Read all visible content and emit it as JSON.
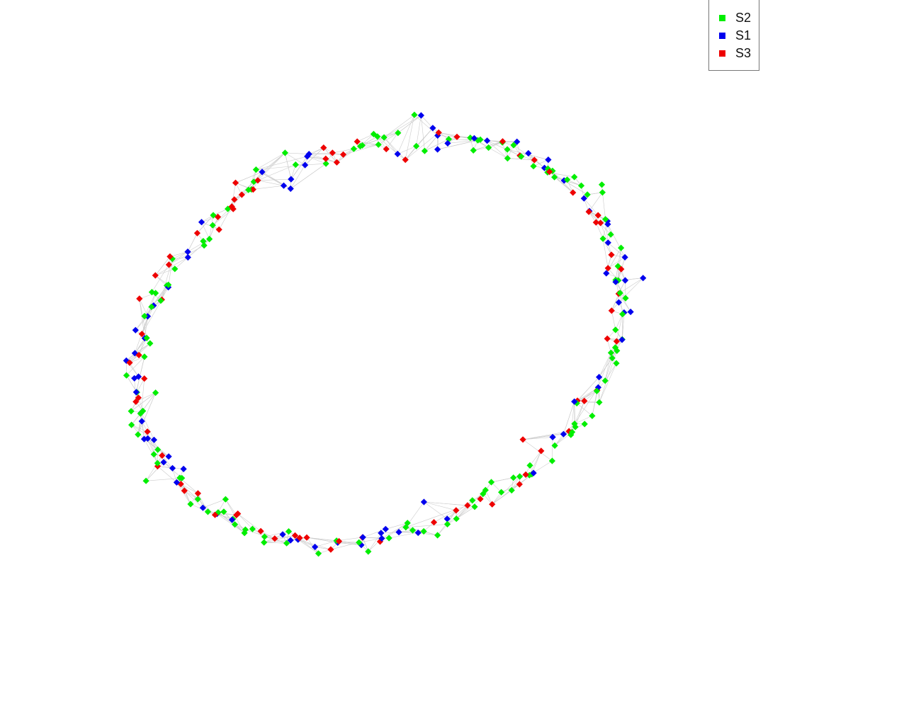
{
  "legend": {
    "items": [
      {
        "label": "S2",
        "color": "#00ee00"
      },
      {
        "label": "S1",
        "color": "#0000ee"
      },
      {
        "label": "S3",
        "color": "#ee0000"
      }
    ]
  },
  "graph": {
    "edge_color": "#cccccc",
    "node_shape": "diamond",
    "layout": "ring",
    "node_counts": {
      "S2": 140,
      "S1": 80,
      "S3": 78
    }
  }
}
